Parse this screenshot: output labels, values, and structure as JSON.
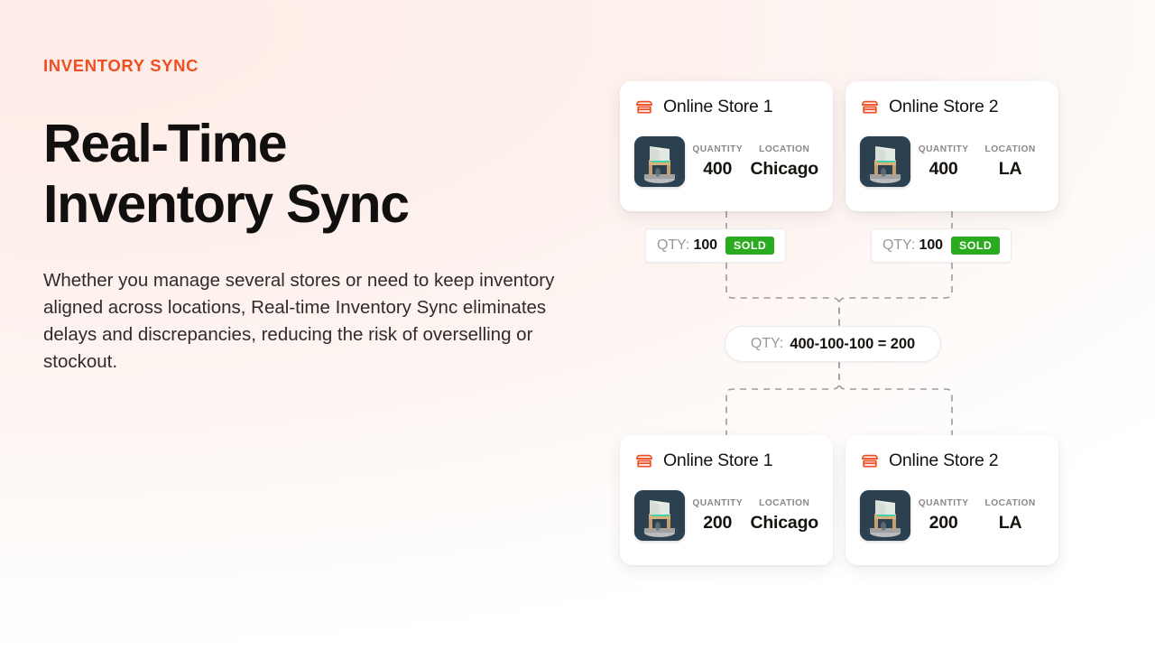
{
  "theme": {
    "accent": "#f04e23",
    "sold_badge": "#2aaa1e",
    "heading_color": "#12100f",
    "muted_text": "#8b8987",
    "card_bg": "#ffffff",
    "background": "#fdeee9"
  },
  "hero": {
    "eyebrow": "INVENTORY SYNC",
    "headline_line1": "Real-Time",
    "headline_line2": "Inventory Sync",
    "body": "Whether you manage several stores or need to keep inventory aligned across locations, Real-time Inventory Sync eliminates delays and discrepancies, reducing the risk of overselling or stockout."
  },
  "diagram": {
    "labels": {
      "quantity": "QUANTITY",
      "location": "LOCATION",
      "qty_prefix": "QTY:",
      "sold": "SOLD"
    },
    "icons": {
      "store": "storefront-icon",
      "product": "armchair-product-thumbnail"
    },
    "top_cards": [
      {
        "title": "Online Store 1",
        "quantity": "400",
        "location": "Chicago"
      },
      {
        "title": "Online Store 2",
        "quantity": "400",
        "location": "LA"
      }
    ],
    "sold_events": [
      {
        "qty": "100",
        "badge": "SOLD"
      },
      {
        "qty": "100",
        "badge": "SOLD"
      }
    ],
    "formula": {
      "label": "QTY:",
      "expression": "400-100-100 = 200"
    },
    "bottom_cards": [
      {
        "title": "Online Store 1",
        "quantity": "200",
        "location": "Chicago"
      },
      {
        "title": "Online Store 2",
        "quantity": "200",
        "location": "LA"
      }
    ]
  }
}
